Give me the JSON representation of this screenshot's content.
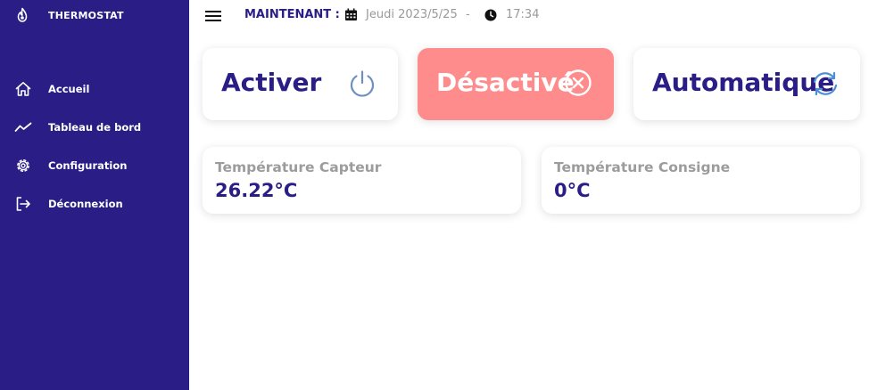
{
  "colors": {
    "sidebar_bg": "#2a1e86",
    "accent": "#2a1e86",
    "disabled_card_bg": "#ff8c8c",
    "muted_text": "#9a9a9a",
    "power_icon": "#6f8fc0",
    "refresh_icon": "#4d8fd6"
  },
  "sidebar": {
    "brand": {
      "label": "THERMOSTAT",
      "icon": "flame-icon"
    },
    "items": [
      {
        "label": "Accueil",
        "icon": "home-icon"
      },
      {
        "label": "Tableau de bord",
        "icon": "trend-line-icon"
      },
      {
        "label": "Configuration",
        "icon": "gear-icon"
      },
      {
        "label": "Déconnexion",
        "icon": "logout-icon"
      }
    ]
  },
  "topbar": {
    "menu_icon": "hamburger-menu-icon",
    "now_label": "MAINTENANT :",
    "date": "Jeudi 2023/5/25",
    "separator": "-",
    "time": "17:34"
  },
  "modes": {
    "activer": {
      "label": "Activer",
      "icon": "power-icon"
    },
    "desactive": {
      "label": "Désactivé",
      "icon": "close-circle-icon"
    },
    "automatique": {
      "label": "Automatique",
      "icon": "refresh-icon"
    }
  },
  "temperatures": {
    "capteur": {
      "title": "Température Capteur",
      "value": "26.22°C"
    },
    "consigne": {
      "title": "Température Consigne",
      "value": "0°C"
    }
  }
}
